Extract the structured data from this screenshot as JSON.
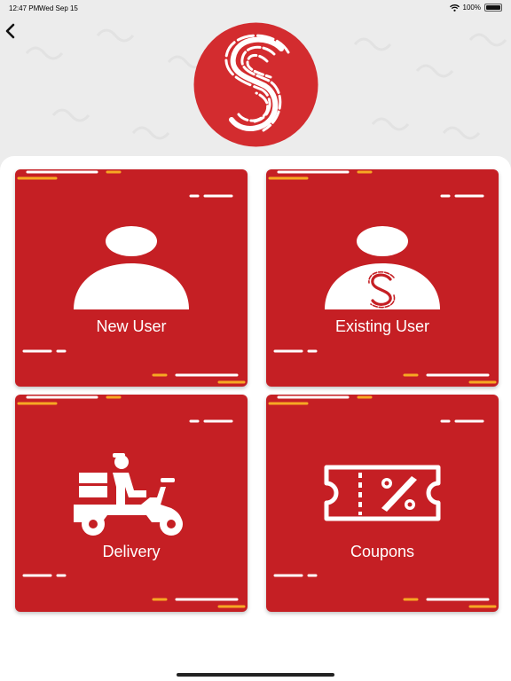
{
  "status_bar": {
    "time": "12:47 PM",
    "date": "Wed Sep 15",
    "battery": "100%"
  },
  "nav": {
    "back_icon": "chevron-left-icon"
  },
  "logo": {
    "icon": "fingerprint-s-logo",
    "color": "#d32c2f"
  },
  "colors": {
    "card_red": "#c51f24",
    "accent_yellow": "#f7a823",
    "white": "#ffffff"
  },
  "menu": {
    "items": [
      {
        "label": "New User",
        "icon": "user-icon"
      },
      {
        "label": "Existing User",
        "icon": "user-fingerprint-icon"
      },
      {
        "label": "Delivery",
        "icon": "delivery-scooter-icon"
      },
      {
        "label": "Coupons",
        "icon": "coupon-percent-icon"
      }
    ]
  }
}
